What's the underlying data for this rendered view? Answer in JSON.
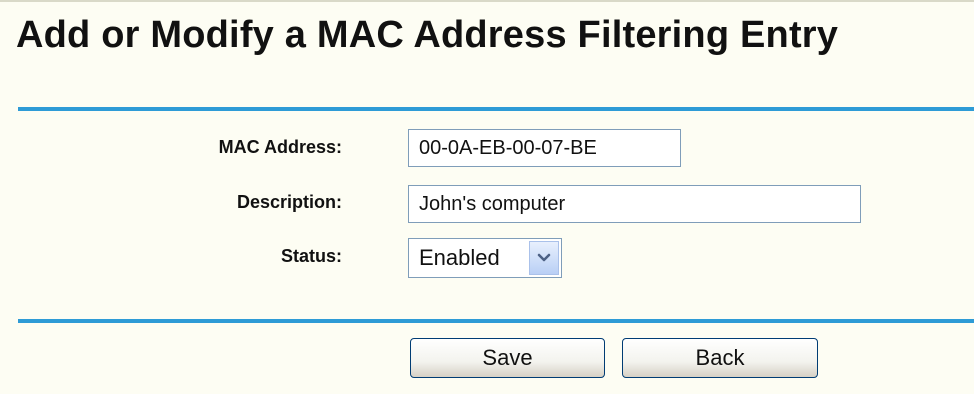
{
  "page": {
    "title": "Add or Modify a MAC Address Filtering Entry"
  },
  "form": {
    "mac_label": "MAC Address:",
    "mac_value": "00-0A-EB-00-07-BE",
    "description_label": "Description:",
    "description_value": "John's computer",
    "status_label": "Status:",
    "status_value": "Enabled",
    "status_icon": "chevron-down-icon"
  },
  "actions": {
    "save_label": "Save",
    "back_label": "Back"
  },
  "colors": {
    "background": "#fdfdf3",
    "divider": "#2e9bd6",
    "field_border": "#7f9db9",
    "button_border": "#003c74"
  }
}
